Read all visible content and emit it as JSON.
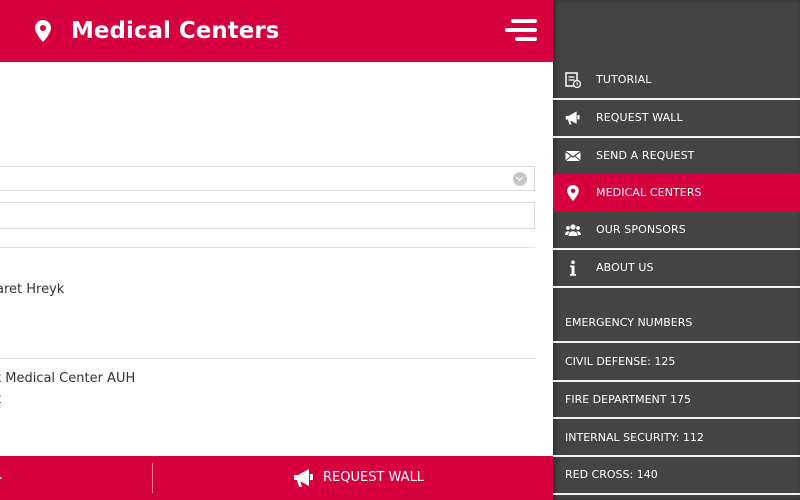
{
  "header": {
    "title": "Medical Centers",
    "icon": "map-pin-icon",
    "menu_icon": "hamburger-menu-icon",
    "color": "#d6003f"
  },
  "content": {
    "rows": [
      {
        "lines": [
          "aret Hreyk"
        ]
      },
      {
        "lines": [
          "t Medical Center AUH",
          "t"
        ]
      }
    ]
  },
  "bottom_bar": {
    "right_tab": {
      "label": "REQUEST WALL",
      "icon": "megaphone-icon"
    }
  },
  "drawer": {
    "background": "#444444",
    "items": [
      {
        "label": "TUTORIAL",
        "icon": "tutorial-icon",
        "active": false
      },
      {
        "label": "REQUEST WALL",
        "icon": "megaphone-icon",
        "active": false
      },
      {
        "label": "SEND A REQUEST",
        "icon": "envelope-icon",
        "active": false
      },
      {
        "label": "MEDICAL CENTERS",
        "icon": "map-pin-icon",
        "active": true
      },
      {
        "label": "OUR SPONSORS",
        "icon": "users-icon",
        "active": false
      },
      {
        "label": "ABOUT US",
        "icon": "info-icon",
        "active": false
      }
    ],
    "emergency": {
      "title": "EMERGENCY NUMBERS",
      "items": [
        {
          "label": "CIVIL DEFENSE: 125"
        },
        {
          "label": "FIRE DEPARTMENT 175"
        },
        {
          "label": "INTERNAL SECURITY: 112"
        },
        {
          "label": "RED CROSS: 140"
        }
      ]
    }
  }
}
